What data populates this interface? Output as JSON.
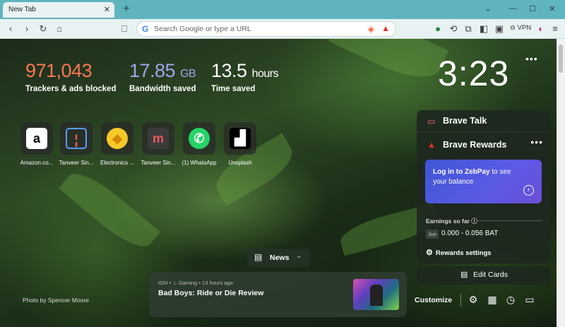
{
  "browser": {
    "tab_title": "New Tab",
    "tab_close_icon": "close-icon",
    "new_tab_label": "+",
    "omnibox_placeholder": "Search Google or type a URL",
    "vpn_label": "VPN",
    "window_controls": [
      "minimize-icon",
      "maximize-icon",
      "close-icon"
    ]
  },
  "stats": {
    "trackers_value": "971,043",
    "trackers_label": "Trackers & ads blocked",
    "bandwidth_value": "17.85",
    "bandwidth_unit": "GB",
    "bandwidth_label": "Bandwidth saved",
    "time_value": "13.5",
    "time_unit": "hours",
    "time_label": "Time saved"
  },
  "colors": {
    "trackers": "#ff7654",
    "bandwidth": "#a0a5eb",
    "time": "#ffffff",
    "titlebar": "#5fb4be"
  },
  "clock": "3:23",
  "top_sites": [
    {
      "name": "Amazon.co...",
      "icon": "amazon-icon"
    },
    {
      "name": "Tanveer Sin...",
      "icon": "tanveer-icon"
    },
    {
      "name": "Electronics ...",
      "icon": "electronics-icon"
    },
    {
      "name": "Tanveer Sin...",
      "icon": "m-icon"
    },
    {
      "name": "(1) WhatsApp",
      "icon": "whatsapp-icon"
    },
    {
      "name": "Unsplash",
      "icon": "unsplash-icon"
    }
  ],
  "cards": {
    "talk_title": "Brave Talk",
    "rewards_title": "Brave Rewards",
    "zebpay_link": "Log in to ZebPay",
    "zebpay_rest": " to see your balance",
    "earnings_label": "Earnings so far",
    "earnings_month": "Jun",
    "earnings_range": "0.000 - 0.056 BAT",
    "rewards_settings": "Rewards settings",
    "edit_cards": "Edit Cards"
  },
  "news": {
    "button_label": "News",
    "source": "IGN",
    "category": "Gaming",
    "time_ago": "13 hours ago",
    "headline": "Bad Boys: Ride or Die Review"
  },
  "footer": {
    "photo_credit": "Photo by Spencer Moore",
    "customize": "Customize"
  }
}
